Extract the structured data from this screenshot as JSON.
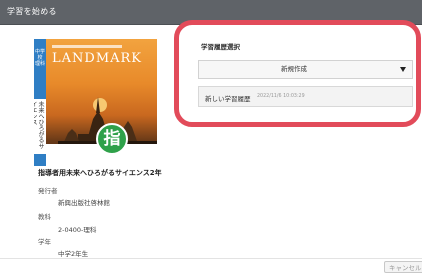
{
  "window": {
    "title": "学習を始める"
  },
  "book": {
    "cover_logo": "LANDMARK",
    "cover_strip_text": "中学校 理科",
    "cover_vertical_text": "未来へひろがるサイエンス",
    "badge": "指",
    "title": "指導者用未来へひろがるサイエンス2年",
    "publisher_label": "発行者",
    "publisher": "新興出版社啓林館",
    "subject_label": "教科",
    "subject": "2-0400-理科",
    "grade_label": "学年",
    "grade": "中学2年生"
  },
  "history_section": {
    "title": "学習履歴選択",
    "select_value": "新規作成",
    "item_label": "新しい学習履歴",
    "item_date": "2022/11/6 10:03:29"
  },
  "footer": {
    "cancel_label": "キャンセル"
  },
  "colors": {
    "titlebar": "#5f6368",
    "highlight": "#e24b5a",
    "badge": "#2fa14a",
    "cover_blue": "#0e6db6"
  }
}
